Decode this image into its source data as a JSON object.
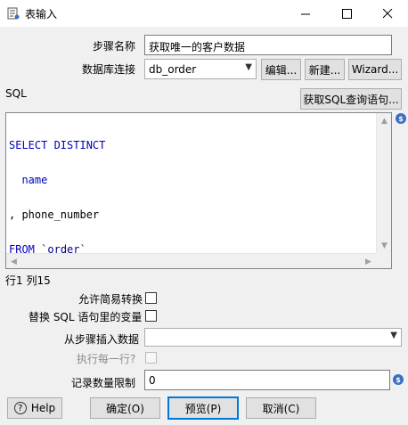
{
  "window": {
    "title": "表输入",
    "minimize_glyph": "—",
    "maximize_glyph": "☐",
    "close_glyph": "✕"
  },
  "form": {
    "step_name_label": "步骤名称",
    "step_name_value": "获取唯一的客户数据",
    "db_conn_label": "数据库连接",
    "db_conn_value": "db_order",
    "edit_button": "编辑...",
    "new_button": "新建...",
    "wizard_button": "Wizard...",
    "sql_label": "SQL",
    "get_sql_button": "获取SQL查询语句..."
  },
  "sql": {
    "line1": "SELECT DISTINCT",
    "line2": "  name",
    "line3": ", phone_number",
    "line4_kw": "FROM",
    "line4_table": "`order`"
  },
  "status": {
    "cursor_position": "行1 列15"
  },
  "options": {
    "lazy_conversion_label": "允许简易转换",
    "replace_vars_label": "替换 SQL 语句里的变量",
    "insert_from_step_label": "从步骤插入数据",
    "insert_from_step_value": "",
    "execute_each_row_label": "执行每一行?",
    "limit_label": "记录数量限制",
    "limit_value": "0"
  },
  "buttons": {
    "help": "Help",
    "ok": "确定(O)",
    "preview": "预览(P)",
    "cancel": "取消(C)"
  },
  "icons": {
    "variable_badge": "$",
    "help_icon": "?"
  }
}
